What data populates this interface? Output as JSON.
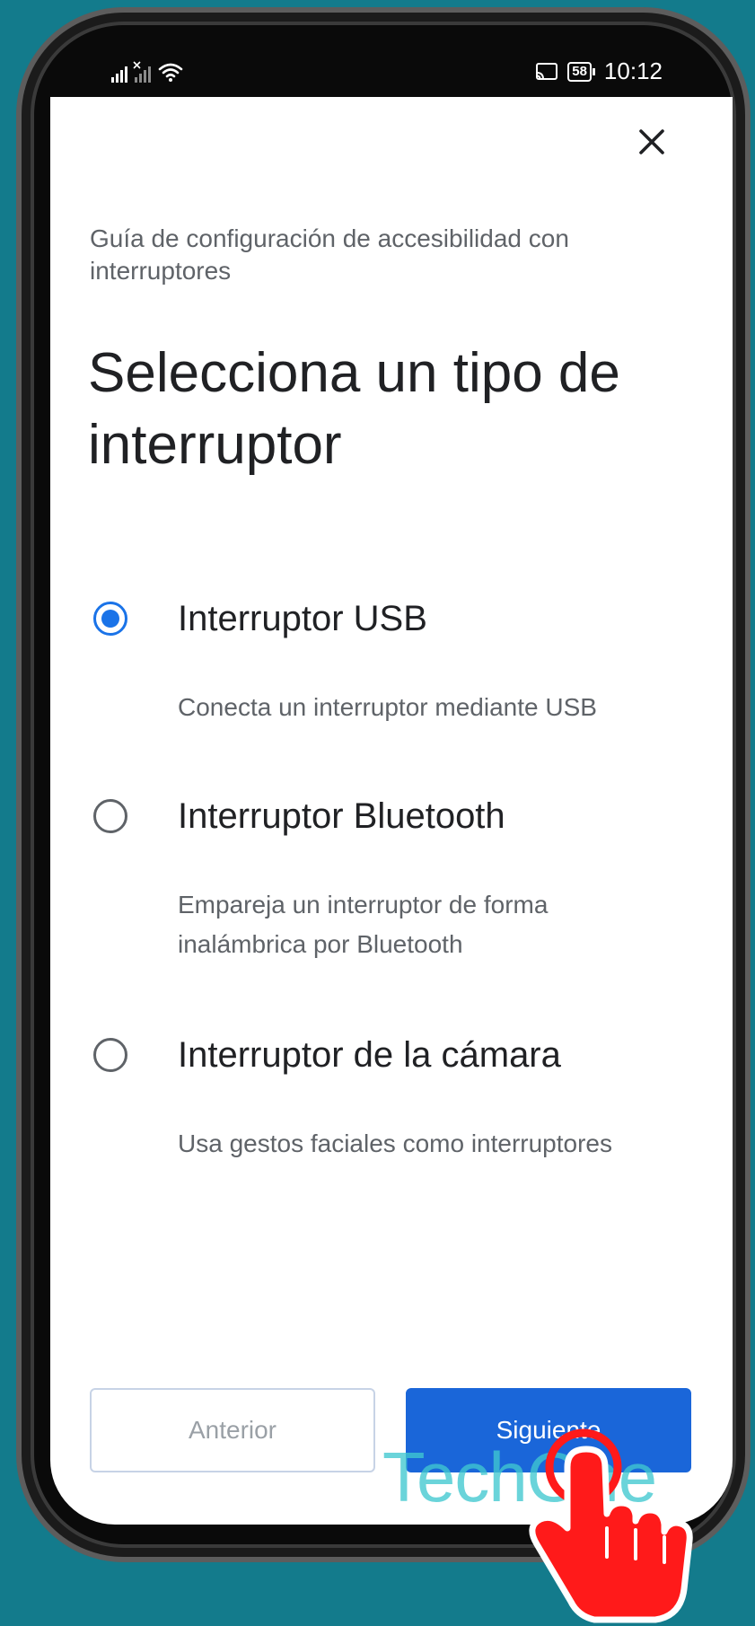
{
  "status_bar": {
    "time": "10:12",
    "battery_level": "58",
    "icons": [
      "signal-icon",
      "signal-no-sim-icon",
      "wifi-icon",
      "cast-icon",
      "battery-icon"
    ]
  },
  "dialog": {
    "close_icon": "close-icon",
    "subtitle": "Guía de configuración de accesibilidad con interruptores",
    "title": "Selecciona un tipo de interruptor",
    "options": [
      {
        "label": "Interruptor USB",
        "description": "Conecta un interruptor mediante USB",
        "selected": true
      },
      {
        "label": "Interruptor Bluetooth",
        "description": "Empareja un interruptor de forma inalámbrica por Bluetooth",
        "selected": false
      },
      {
        "label": "Interruptor de la cámara",
        "description": "Usa gestos faciales como interruptores",
        "selected": false
      }
    ],
    "buttons": {
      "previous": "Anterior",
      "next": "Siguiente"
    }
  },
  "watermark": "TechOne",
  "colors": {
    "accent": "#1a73e8",
    "button_primary": "#1a66d9",
    "background": "#137b8c",
    "tap_hand": "#ff1a1a"
  }
}
